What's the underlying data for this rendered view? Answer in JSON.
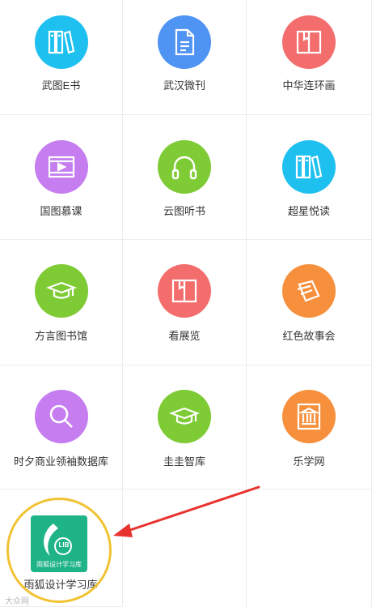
{
  "items": [
    {
      "label": "武图E书",
      "color": "#1ec0f0",
      "icon": "books-icon"
    },
    {
      "label": "武汉微刊",
      "color": "#4f93f3",
      "icon": "document-icon"
    },
    {
      "label": "中华连环画",
      "color": "#f36d6d",
      "icon": "open-book-icon"
    },
    {
      "label": "国图慕课",
      "color": "#c57df0",
      "icon": "video-icon"
    },
    {
      "label": "云图听书",
      "color": "#7ecb35",
      "icon": "headphones-icon"
    },
    {
      "label": "超星悦读",
      "color": "#1ec0f0",
      "icon": "books-icon"
    },
    {
      "label": "方言图书馆",
      "color": "#7ecb35",
      "icon": "graduation-cap-icon"
    },
    {
      "label": "看展览",
      "color": "#f36d6d",
      "icon": "open-book-icon"
    },
    {
      "label": "红色故事会",
      "color": "#f7903c",
      "icon": "magazines-icon"
    },
    {
      "label": "时夕商业领袖数据库",
      "color": "#c57df0",
      "icon": "search-icon"
    },
    {
      "label": "圭圭智库",
      "color": "#7ecb35",
      "icon": "graduation-cap-icon"
    },
    {
      "label": "乐学网",
      "color": "#f7903c",
      "icon": "library-icon"
    }
  ],
  "last_item": {
    "label": "雨狐设计学习库",
    "logo_text": "LIB",
    "logo_caption": "雨狐设计学习库",
    "icon": "lib-logo-icon",
    "accent": "#1fb388"
  },
  "highlight": {
    "ring_color": "#f1c232",
    "arrow_color": "#e8322f"
  },
  "watermark": "大众网"
}
